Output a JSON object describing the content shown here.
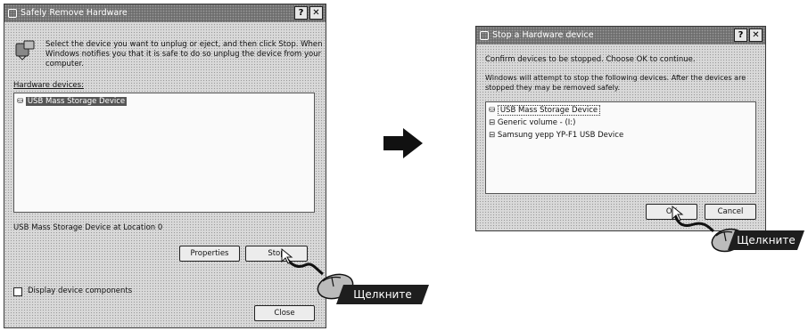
{
  "dialog_left": {
    "title": "Safely Remove Hardware",
    "instruction_line1": "Select the device you want to unplug or eject, and then click Stop. When",
    "instruction_line2": "Windows notifies you that it is safe to do so unplug the device from your",
    "instruction_line3": "computer.",
    "list_label": "Hardware devices:",
    "selected_device": "USB Mass Storage Device",
    "status_text": "USB Mass Storage Device at Location 0",
    "properties_button": "Properties",
    "stop_button": "Stop",
    "display_components_label": "Display device components",
    "close_button": "Close"
  },
  "dialog_right": {
    "title": "Stop a Hardware device",
    "confirm_text": "Confirm devices to be stopped. Choose OK to continue.",
    "info_line1": "Windows will attempt to stop the following devices. After the devices are",
    "info_line2": "stopped they may be removed safely.",
    "devices": [
      "USB Mass Storage Device",
      "Generic volume - (I:)",
      "Samsung yepp  YP-F1  USB Device"
    ],
    "ok_button": "OK",
    "cancel_button": "Cancel"
  },
  "callouts": {
    "left": "Щелкните",
    "right": "Щелкните"
  },
  "colors": {
    "titlebar": "#6e6e6e",
    "dialog_bg": "#d9d9d9",
    "callout_bg": "#1e1e1e"
  }
}
